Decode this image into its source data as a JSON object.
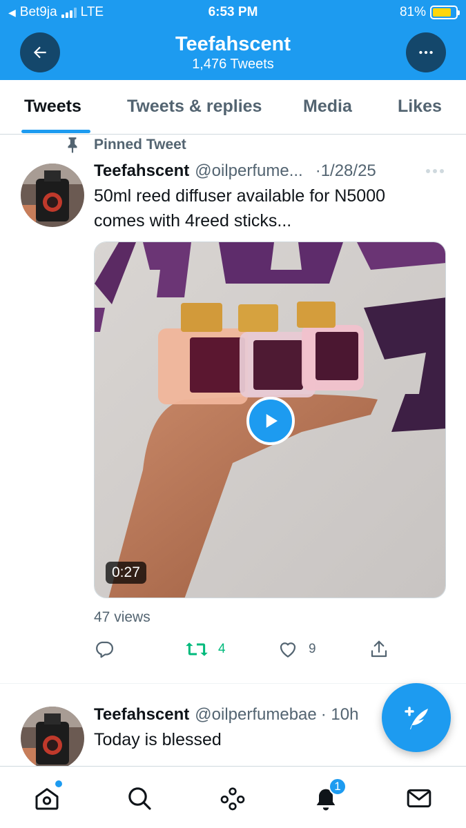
{
  "status_bar": {
    "back_app": "Bet9ja",
    "network": "LTE",
    "time": "6:53 PM",
    "battery": "81%",
    "battery_level": 0.81
  },
  "header": {
    "title": "Teefahscent",
    "subtitle": "1,476 Tweets",
    "back_icon": "arrow-left-icon",
    "more_icon": "more-horizontal-icon"
  },
  "tabs": [
    {
      "label": "Tweets",
      "active": true
    },
    {
      "label": "Tweets & replies",
      "active": false
    },
    {
      "label": "Media",
      "active": false
    },
    {
      "label": "Likes",
      "active": false
    }
  ],
  "pinned_tweet": {
    "pinned_label": "Pinned Tweet",
    "name": "Teefahscent",
    "handle": "@oilperfume...",
    "date": "·1/28/25",
    "text_line1": "50ml reed diffuser available for N5000",
    "text_line2": "comes with 4reed sticks...",
    "video_duration": "0:27",
    "views": "47 views",
    "retweets": "4",
    "likes": "9"
  },
  "second_tweet": {
    "name": "Teefahscent",
    "handle": "@oilperfumebae",
    "time": "· 10h",
    "text": "Today is blessed"
  },
  "bottom_nav": {
    "items": [
      "home-icon",
      "search-icon",
      "spaces-icon",
      "notifications-icon",
      "messages-icon"
    ],
    "notification_count": "1"
  },
  "colors": {
    "accent": "#1d9bf0",
    "header_button": "#14476b",
    "retweet_green": "#00ba7c",
    "muted_text": "#536471"
  }
}
